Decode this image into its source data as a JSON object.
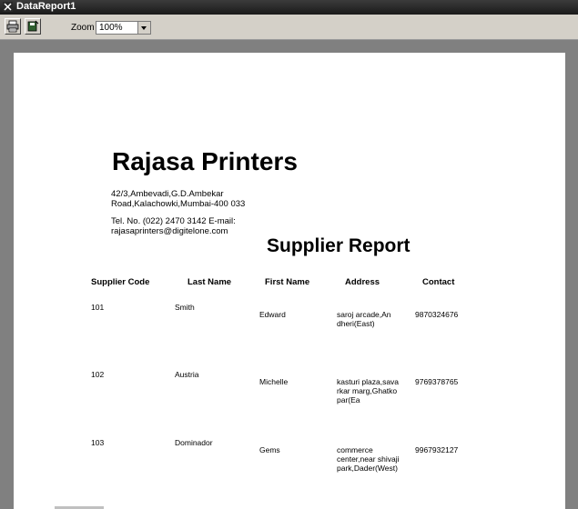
{
  "window": {
    "title": "DataReport1"
  },
  "toolbar": {
    "print_icon": "printer-icon",
    "export_icon": "export-icon",
    "zoom_label": "Zoom",
    "zoom_value": "100%"
  },
  "report": {
    "company": "Rajasa Printers",
    "address": "42/3,Ambevadi,G.D.Ambekar Road,Kalachowki,Mumbai-400 033",
    "contact_line": "Tel. No. (022) 2470 3142 E-mail: rajasaprinters@digitelone.com",
    "title": "Supplier Report",
    "columns": {
      "code": "Supplier Code",
      "last": "Last Name",
      "first": "First Name",
      "address": "Address",
      "contact": "Contact"
    },
    "rows": [
      {
        "code": "101",
        "last": "Smith",
        "first": "Edward",
        "address": "saroj arcade,Andheri(East)",
        "contact": "9870324676"
      },
      {
        "code": "102",
        "last": "Austria",
        "first": "Michelle",
        "address": "kasturi plaza,savarkar marg,Ghatkopar(Ea",
        "contact": "9769378765"
      },
      {
        "code": "103",
        "last": "Dominador",
        "first": "Gems",
        "address": "commerce center,near shivaji park,Dader(West)",
        "contact": "9967932127"
      }
    ]
  }
}
